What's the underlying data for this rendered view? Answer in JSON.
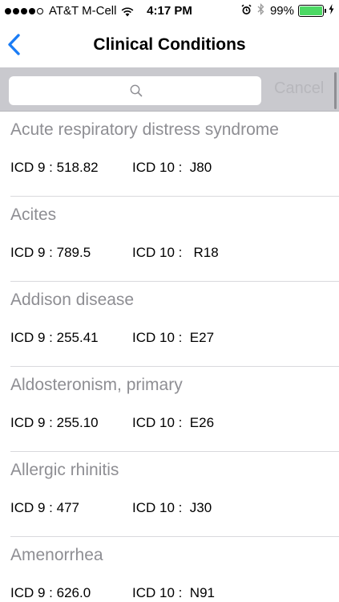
{
  "status_bar": {
    "signal_dots_filled": 4,
    "signal_dots_total": 5,
    "carrier": "AT&T M-Cell",
    "time": "4:17 PM",
    "battery_percent": "99%",
    "battery_level": 0.99,
    "battery_color": "#4cd964",
    "icons": [
      "wifi-icon",
      "alarm-icon",
      "bluetooth-icon",
      "charging-icon"
    ]
  },
  "nav": {
    "title": "Clinical Conditions",
    "back_icon": "chevron-left-icon",
    "accent_color": "#1a7cf5"
  },
  "search": {
    "placeholder": "",
    "value": "",
    "icon": "search-icon",
    "cancel_label": "Cancel"
  },
  "conditions": [
    {
      "name": "Acute respiratory distress syndrome",
      "icd9": "ICD 9 : 518.82",
      "icd10": "ICD 10 :  J80"
    },
    {
      "name": "Acites",
      "icd9": "ICD 9 : 789.5",
      "icd10": "ICD 10 :   R18"
    },
    {
      "name": "Addison disease",
      "icd9": "ICD 9 : 255.41",
      "icd10": "ICD 10 :  E27"
    },
    {
      "name": "Aldosteronism, primary",
      "icd9": "ICD 9 : 255.10",
      "icd10": "ICD 10 :  E26"
    },
    {
      "name": "Allergic rhinitis",
      "icd9": "ICD 9 : 477",
      "icd10": "ICD 10 :  J30"
    },
    {
      "name": "Amenorrhea",
      "icd9": "ICD 9 : 626.0",
      "icd10": "ICD 10 :  N91"
    }
  ]
}
